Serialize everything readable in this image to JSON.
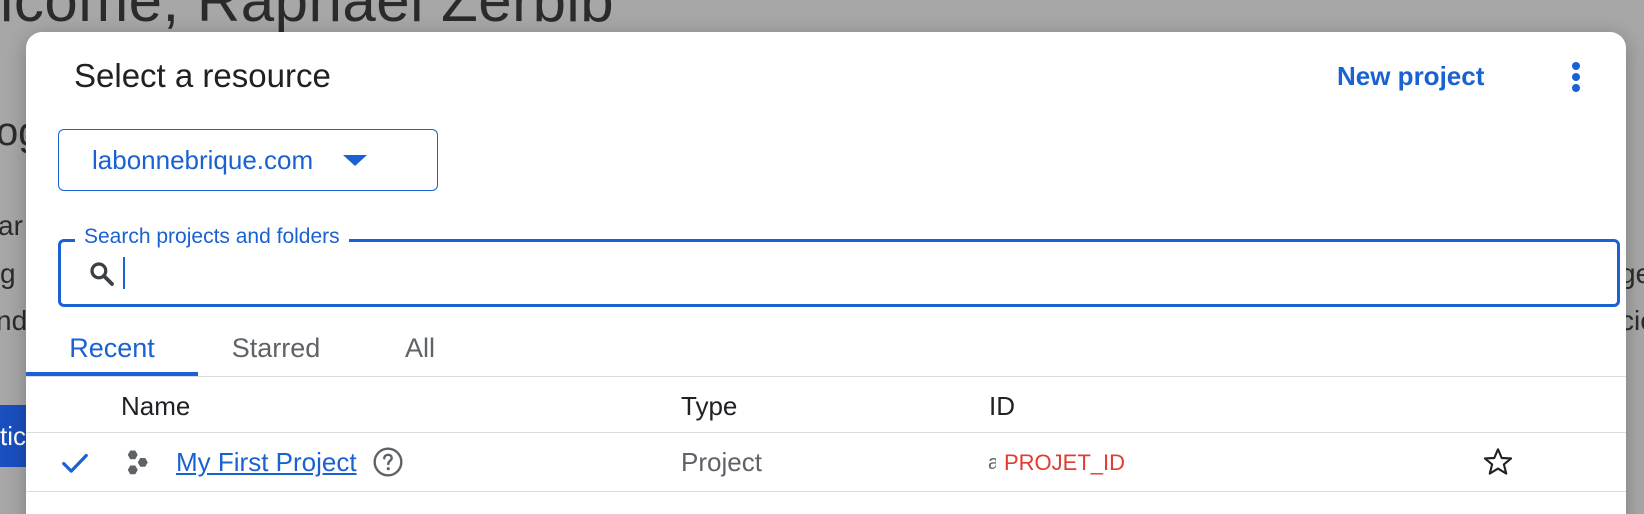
{
  "background": {
    "title_fragment": "lcome, Raphael Zerbib",
    "fragments": [
      "og",
      "ar",
      "g",
      "nd",
      "tic",
      "ge",
      "cie"
    ]
  },
  "dialog": {
    "title": "Select a resource",
    "new_project_label": "New project",
    "more_icon": "more-vert-icon",
    "organization": {
      "selected": "labonnebrique.com"
    },
    "search": {
      "label": "Search projects and folders",
      "value": "",
      "placeholder": ""
    },
    "tabs": [
      {
        "label": "Recent",
        "active": true
      },
      {
        "label": "Starred",
        "active": false
      },
      {
        "label": "All",
        "active": false
      }
    ],
    "table": {
      "columns": [
        "Name",
        "Type",
        "ID"
      ],
      "rows": [
        {
          "selected": true,
          "name": "My First Project",
          "type": "Project",
          "id_prefix": "a",
          "id": "PROJET_ID",
          "starred": false
        }
      ]
    }
  },
  "colors": {
    "accent": "#1a62d1",
    "id_text": "#e03c31",
    "overlay": "#a7a7a7"
  }
}
